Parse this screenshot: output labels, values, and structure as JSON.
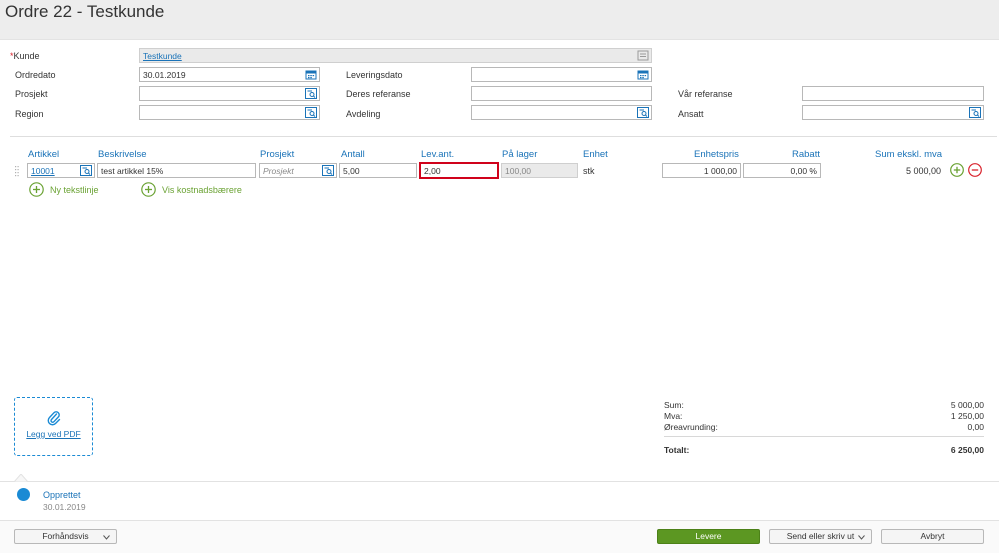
{
  "page": {
    "title": "Ordre 22 - Testkunde"
  },
  "form": {
    "kunde_required": "*",
    "kunde_label": "Kunde",
    "kunde_value": "Testkunde",
    "ordredato_label": "Ordredato",
    "ordredato_value": "30.01.2019",
    "prosjekt_label": "Prosjekt",
    "prosjekt_value": "",
    "region_label": "Region",
    "region_value": "",
    "leveringsdato_label": "Leveringsdato",
    "leveringsdato_value": "",
    "deres_referanse_label": "Deres referanse",
    "deres_referanse_value": "",
    "avdeling_label": "Avdeling",
    "avdeling_value": "",
    "var_referanse_label": "Vår referanse",
    "var_referanse_value": "",
    "ansatt_label": "Ansatt",
    "ansatt_value": ""
  },
  "table": {
    "headers": {
      "artikkel": "Artikkel",
      "beskrivelse": "Beskrivelse",
      "prosjekt": "Prosjekt",
      "antall": "Antall",
      "lev_ant": "Lev.ant.",
      "pa_lager": "På lager",
      "enhet": "Enhet",
      "enhetspris": "Enhetspris",
      "rabatt": "Rabatt",
      "sum": "Sum ekskl. mva"
    },
    "rows": [
      {
        "artikkel": "10001",
        "beskrivelse": "test artikkel 15%",
        "prosjekt_placeholder": "Prosjekt",
        "antall": "5,00",
        "lev_ant": "2,00",
        "pa_lager": "100,00",
        "enhet": "stk",
        "enhetspris": "1 000,00",
        "rabatt": "0,00 %",
        "sum": "5 000,00"
      }
    ],
    "add_text_line": "Ny tekstlinje",
    "show_cost_carriers": "Vis kostnadsbærere"
  },
  "attachment": {
    "label": "Legg ved PDF"
  },
  "totals": {
    "sum_label": "Sum:",
    "sum_value": "5 000,00",
    "mva_label": "Mva:",
    "mva_value": "1 250,00",
    "oreavrunding_label": "Øreavrunding:",
    "oreavrunding_value": "0,00",
    "totalt_label": "Totalt:",
    "totalt_value": "6 250,00"
  },
  "timeline": {
    "status": "Opprettet",
    "date": "30.01.2019"
  },
  "footer": {
    "preview": "Forhåndsvis",
    "deliver": "Levere",
    "send_print": "Send eller skriv ut",
    "cancel": "Avbryt"
  },
  "colors": {
    "accent": "#1a73b8",
    "primary_button": "#5c9722",
    "add_green": "#6aa233",
    "remove_red": "#d9232d",
    "active_field_border": "#d0021b",
    "timeline_dot": "#1a8ad4"
  },
  "icons": [
    "lookup-icon",
    "calendar-icon",
    "search-list-icon",
    "paperclip-icon",
    "plus-circle-icon",
    "minus-circle-icon",
    "chevron-down-icon",
    "drag-handle-icon"
  ]
}
